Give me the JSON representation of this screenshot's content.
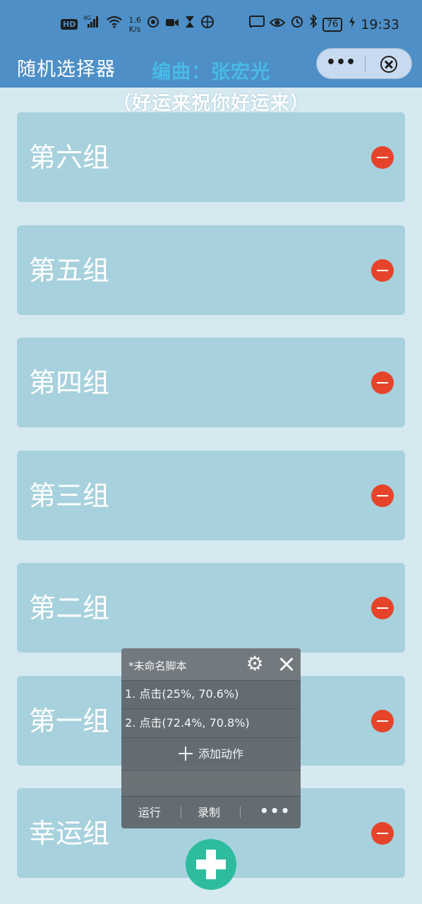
{
  "status_bar": {
    "hd_label": "HD",
    "net_type": "4G",
    "net_speed_value": "1.6",
    "net_speed_unit": "K/s",
    "battery_level": "76",
    "time": "19:33"
  },
  "header": {
    "title": "随机选择器",
    "more_glyph": "•••"
  },
  "subtitle": {
    "line1": "编曲：张宏光",
    "line2": "（好运来祝你好运来）"
  },
  "groups": [
    {
      "name": "第六组"
    },
    {
      "name": "第五组"
    },
    {
      "name": "第四组"
    },
    {
      "name": "第三组"
    },
    {
      "name": "第二组"
    },
    {
      "name": "第一组"
    },
    {
      "name": "幸运组"
    }
  ],
  "script_panel": {
    "title": "*未命名脚本",
    "actions": [
      {
        "label": "1. 点击(25%, 70.6%)"
      },
      {
        "label": "2. 点击(72.4%, 70.8%)"
      }
    ],
    "add_action_label": "添加动作",
    "run_label": "运行",
    "record_label": "录制",
    "more_glyph": "•••"
  },
  "colors": {
    "header_bg": "#4d8fc6",
    "page_bg": "#d6e9f0",
    "card_bg": "#a7d1dd",
    "remove_red": "#e6442a",
    "fab_green": "#2dbd9e",
    "subtitle_blue": "#49b9e8"
  }
}
